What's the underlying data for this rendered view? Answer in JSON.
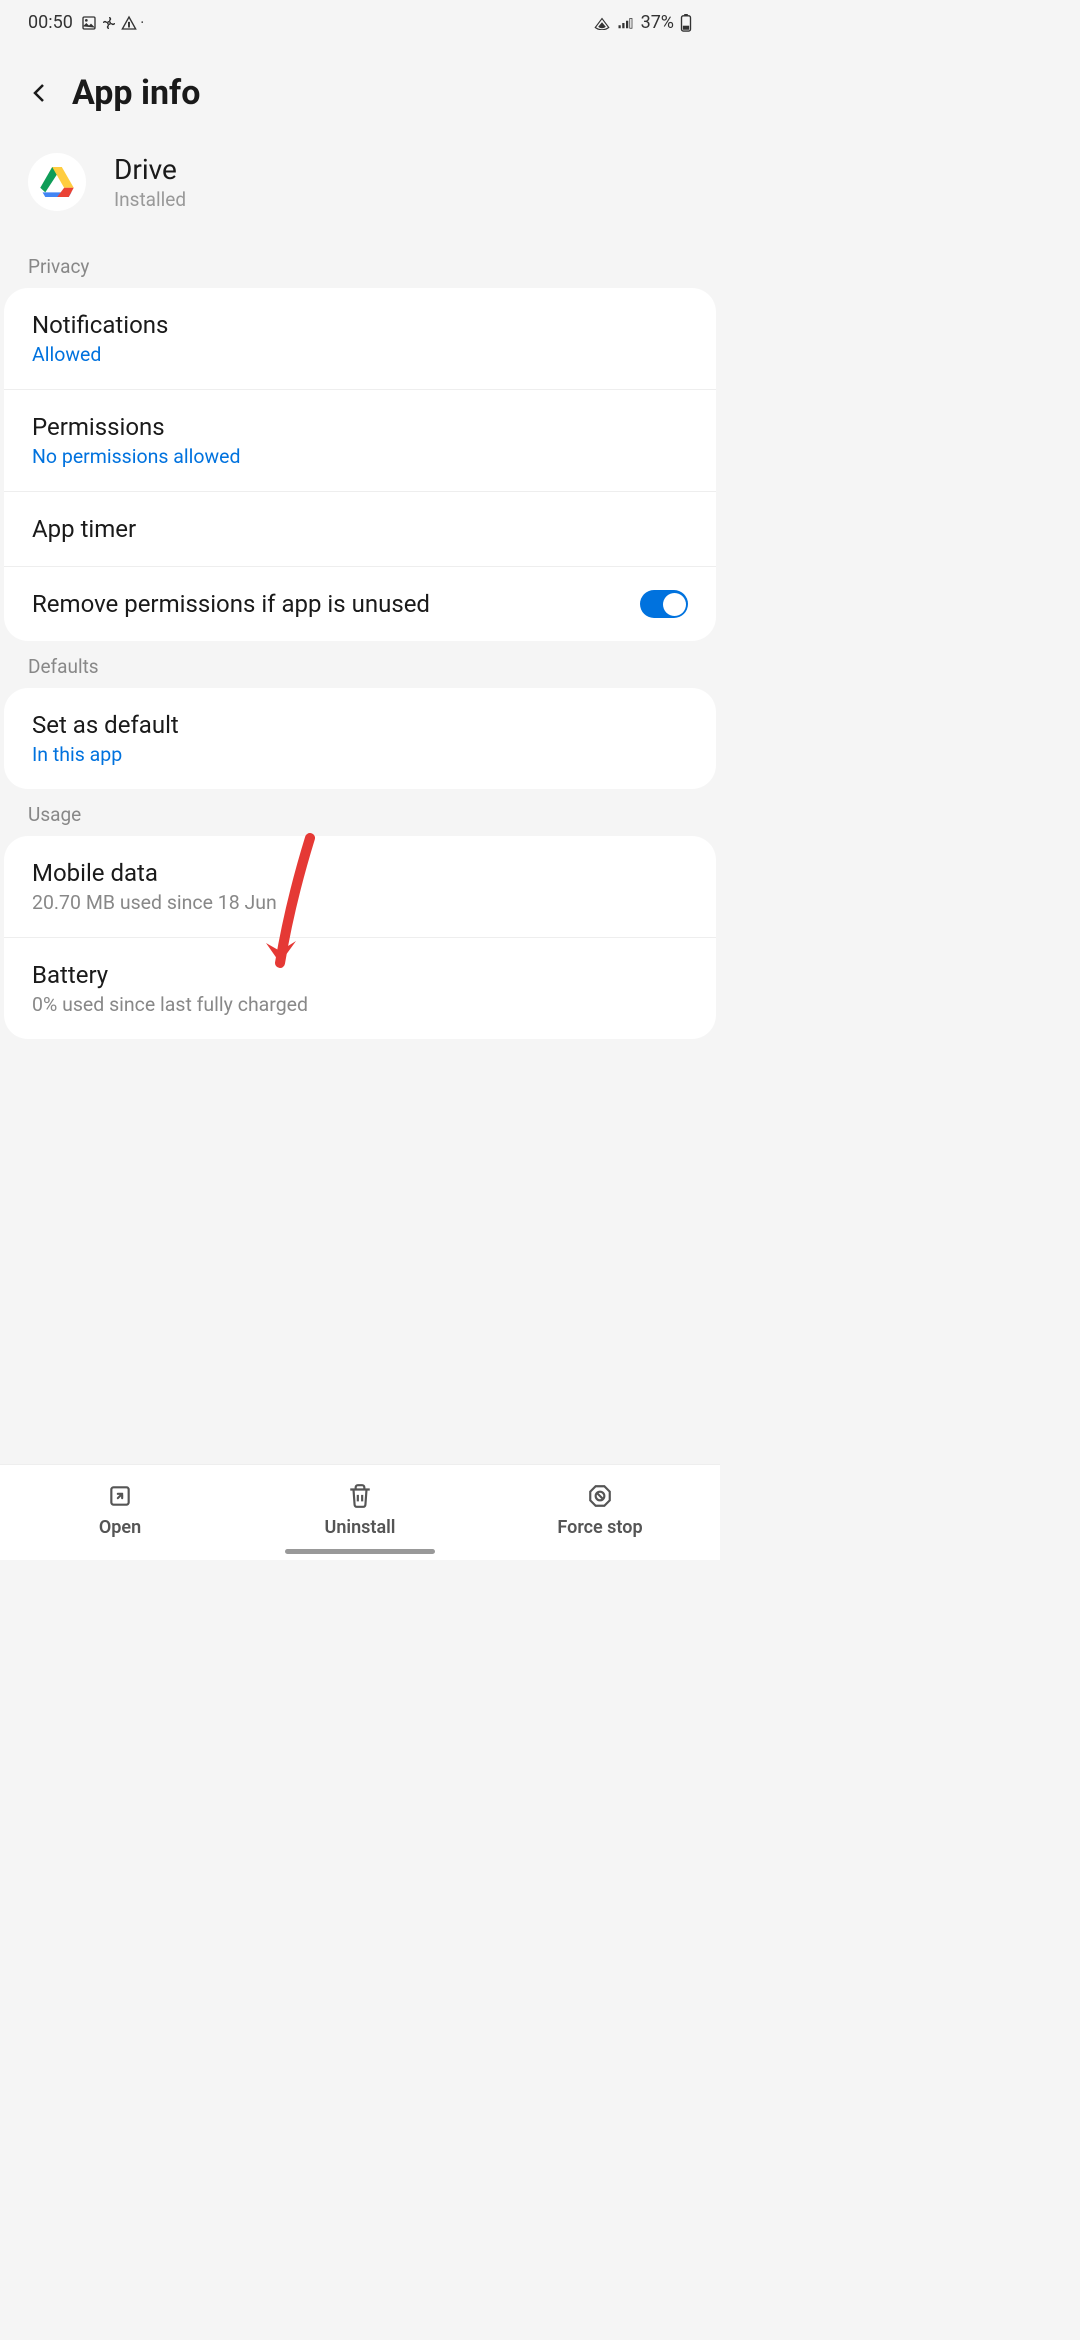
{
  "status_bar": {
    "time": "00:50",
    "battery": "37%"
  },
  "header": {
    "title": "App info"
  },
  "app": {
    "name": "Drive",
    "status": "Installed"
  },
  "privacy": {
    "label": "Privacy",
    "notifications": {
      "title": "Notifications",
      "subtitle": "Allowed"
    },
    "permissions": {
      "title": "Permissions",
      "subtitle": "No permissions allowed"
    },
    "app_timer": {
      "title": "App timer"
    },
    "remove_unused": {
      "title": "Remove permissions if app is unused"
    }
  },
  "defaults": {
    "label": "Defaults",
    "set_default": {
      "title": "Set as default",
      "subtitle": "In this app"
    }
  },
  "usage": {
    "label": "Usage",
    "mobile_data": {
      "title": "Mobile data",
      "subtitle": "20.70 MB used since 18 Jun"
    },
    "battery": {
      "title": "Battery",
      "subtitle": "0% used since last fully charged"
    }
  },
  "bottom_bar": {
    "open": "Open",
    "uninstall": "Uninstall",
    "force_stop": "Force stop"
  }
}
